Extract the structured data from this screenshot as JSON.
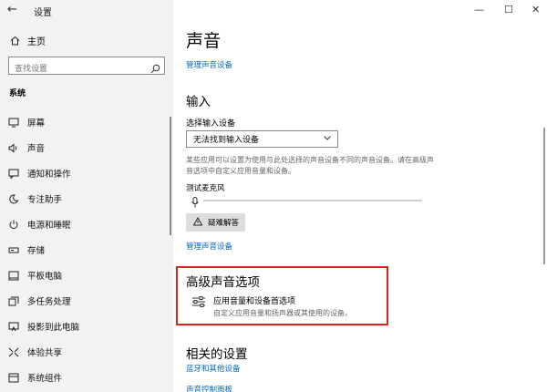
{
  "window": {
    "title": "设置",
    "minimize": "—",
    "maximize": "☐",
    "close": "✕"
  },
  "sidebar": {
    "back": "←",
    "home": "主页",
    "search_placeholder": "查找设置",
    "section": "系统",
    "items": [
      {
        "label": "屏幕",
        "icon": "monitor-icon"
      },
      {
        "label": "声音",
        "icon": "speaker-icon",
        "active": true
      },
      {
        "label": "通知和操作",
        "icon": "notification-icon"
      },
      {
        "label": "专注助手",
        "icon": "moon-icon"
      },
      {
        "label": "电源和睡眠",
        "icon": "power-icon"
      },
      {
        "label": "存储",
        "icon": "storage-icon"
      },
      {
        "label": "平板电脑",
        "icon": "tablet-icon"
      },
      {
        "label": "多任务处理",
        "icon": "multitask-icon"
      },
      {
        "label": "投影到此电脑",
        "icon": "project-icon"
      },
      {
        "label": "体验共享",
        "icon": "share-icon"
      },
      {
        "label": "系统组件",
        "icon": "components-icon"
      }
    ]
  },
  "main": {
    "title": "声音",
    "manage_devices_top": "管理声音设备",
    "input_heading": "输入",
    "choose_input_label": "选择输入设备",
    "input_device_value": "无法找到输入设备",
    "input_description": "某些应用可以设置为使用与此处选择的声音设备不同的声音设备。请在高级声音选项中自定义应用音量和设备。",
    "test_mic_label": "测试麦克风",
    "troubleshoot_label": "疑难解答",
    "manage_devices_input": "管理声音设备",
    "advanced_heading": "高级声音选项",
    "app_volume_title": "应用音量和设备首选项",
    "app_volume_sub": "自定义应用音量和扬声器或其使用的设备。",
    "related_heading": "相关的设置",
    "bluetooth_link": "蓝牙和其他设备",
    "control_panel_link": "声音控制面板"
  },
  "colors": {
    "accent": "#0067c0",
    "highlight_border": "#e02020",
    "sidebar_bg": "#f2f2f2"
  }
}
